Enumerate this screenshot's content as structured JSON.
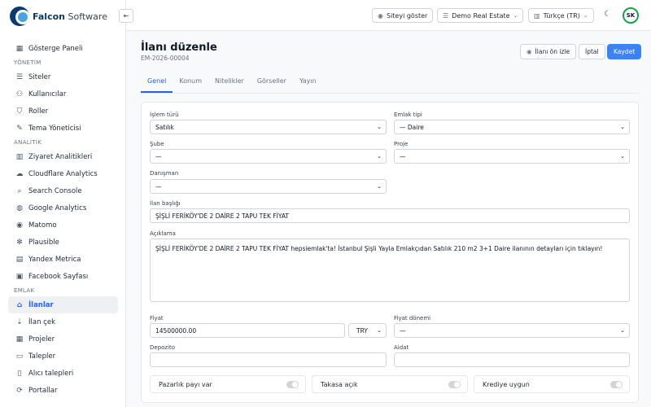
{
  "brand": {
    "name_bold": "Falcon",
    "name_rest": " Software"
  },
  "sidebar": {
    "items": [
      {
        "type": "item",
        "label": "Gösterge Paneli",
        "icon": "dashboard-icon",
        "glyph": "▦"
      },
      {
        "type": "section",
        "label": "YÖNETİM"
      },
      {
        "type": "item",
        "label": "Siteler",
        "icon": "database-icon",
        "glyph": "☰"
      },
      {
        "type": "item",
        "label": "Kullanıcılar",
        "icon": "users-icon",
        "glyph": "⚇"
      },
      {
        "type": "item",
        "label": "Roller",
        "icon": "shield-icon",
        "glyph": "⛉"
      },
      {
        "type": "item",
        "label": "Tema Yöneticisi",
        "icon": "palette-icon",
        "glyph": "✎"
      },
      {
        "type": "section",
        "label": "ANALİTİK"
      },
      {
        "type": "item",
        "label": "Ziyaret Analitikleri",
        "icon": "chart-icon",
        "glyph": "▥"
      },
      {
        "type": "item",
        "label": "Cloudflare Analytics",
        "icon": "cloud-icon",
        "glyph": "☁"
      },
      {
        "type": "item",
        "label": "Search Console",
        "icon": "search-icon",
        "glyph": "⌕"
      },
      {
        "type": "item",
        "label": "Google Analytics",
        "icon": "globe-icon",
        "glyph": "◍"
      },
      {
        "type": "item",
        "label": "Matomo",
        "icon": "matomo-icon",
        "glyph": "◉"
      },
      {
        "type": "item",
        "label": "Plausible",
        "icon": "plausible-icon",
        "glyph": "✻"
      },
      {
        "type": "item",
        "label": "Yandex Metrica",
        "icon": "yandex-icon",
        "glyph": "▤"
      },
      {
        "type": "item",
        "label": "Facebook Sayfası",
        "icon": "facebook-icon",
        "glyph": "▣"
      },
      {
        "type": "section",
        "label": "EMLAK"
      },
      {
        "type": "item",
        "label": "İlanlar",
        "icon": "home-icon",
        "glyph": "⌂",
        "active": true
      },
      {
        "type": "item",
        "label": "İlan çek",
        "icon": "download-icon",
        "glyph": "⇣"
      },
      {
        "type": "item",
        "label": "Projeler",
        "icon": "building-icon",
        "glyph": "▦"
      },
      {
        "type": "item",
        "label": "Talepler",
        "icon": "inbox-icon",
        "glyph": "▭"
      },
      {
        "type": "item",
        "label": "Alıcı talepleri",
        "icon": "doc-icon",
        "glyph": "▯"
      },
      {
        "type": "item",
        "label": "Portallar",
        "icon": "sync-icon",
        "glyph": "⟳"
      }
    ]
  },
  "topbar": {
    "view_site": "Siteyi göster",
    "site_select": "Demo Real Estate",
    "language": "Türkçe (TR)",
    "avatar_initials": "SK"
  },
  "page": {
    "title": "İlanı düzenle",
    "code": "EM-2026-00004",
    "preview_label": "İlanı ön izle",
    "cancel_label": "İptal",
    "save_label": "Kaydet"
  },
  "tabs": [
    "Genel",
    "Konum",
    "Nitelikler",
    "Görseller",
    "Yayın"
  ],
  "form": {
    "islem_turu": {
      "label": "İşlem türü",
      "value": "Satılık"
    },
    "emlak_tipi": {
      "label": "Emlak tipi",
      "value": "— Daire"
    },
    "sube": {
      "label": "Şube",
      "value": "—"
    },
    "proje": {
      "label": "Proje",
      "value": "—"
    },
    "danisman": {
      "label": "Danışman",
      "value": "—"
    },
    "ilan_basligi": {
      "label": "İlan başlığı",
      "value": "ŞİŞLİ FERİKÖY'DE 2 DAİRE 2 TAPU TEK FİYAT"
    },
    "aciklama": {
      "label": "Açıklama",
      "value": "ŞİŞLİ FERİKÖY'DE 2 DAİRE 2 TAPU TEK FİYAT hepsiemlak'ta! İstanbul Şişli Yayla Emlakçıdan Satılık 210 m2 3+1 Daire ilanının detayları için tıklayın!"
    },
    "fiyat": {
      "label": "Fiyat",
      "value": "14500000.00"
    },
    "para_birimi": {
      "value": "TRY"
    },
    "fiyat_donemi": {
      "label": "Fiyat dönemi",
      "value": "—"
    },
    "depozito": {
      "label": "Depozito",
      "value": ""
    },
    "aidat": {
      "label": "Aidat",
      "value": ""
    },
    "toggles": [
      {
        "label": "Pazarlık payı var",
        "on": false
      },
      {
        "label": "Takasa açık",
        "on": false
      },
      {
        "label": "Krediye uygun",
        "on": false
      }
    ]
  }
}
